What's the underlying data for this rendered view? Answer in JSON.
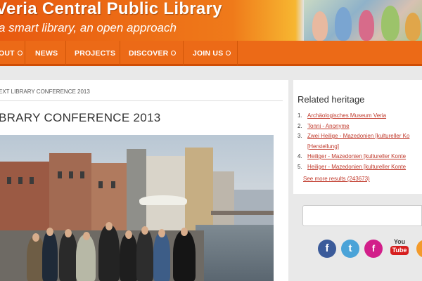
{
  "header": {
    "title": "Veria Central Public Library",
    "tagline": "a smart library, an open approach"
  },
  "nav": {
    "items": [
      {
        "label": "OUT",
        "has_submenu": true
      },
      {
        "label": "NEWS",
        "has_submenu": false
      },
      {
        "label": "PROJECTS",
        "has_submenu": false
      },
      {
        "label": "DISCOVER",
        "has_submenu": true
      },
      {
        "label": "JOIN US",
        "has_submenu": true
      }
    ]
  },
  "main": {
    "breadcrumb": "EXT LIBRARY CONFERENCE 2013",
    "title": "BRARY CONFERENCE 2013"
  },
  "sidebar": {
    "title": "Related heritage",
    "items": [
      {
        "num": "1.",
        "label": "Archäologisches Museum Veria"
      },
      {
        "num": "2.",
        "label": "Tonni - Anonyme"
      },
      {
        "num": "3.",
        "label": "Zwei Heilige - Mazedonien [kultureller Ko"
      },
      {
        "num": "",
        "label": "[Herstellung]"
      },
      {
        "num": "4.",
        "label": "Heiliger - Mazedonien [kultureller Konte"
      },
      {
        "num": "5.",
        "label": "Heiliger - Mazedonien [kultureller Konte"
      }
    ],
    "see_more": "See more results (243673)",
    "social": [
      {
        "icon": "facebook-icon",
        "glyph": "f"
      },
      {
        "icon": "twitter-icon",
        "glyph": "t"
      },
      {
        "icon": "flickr-icon",
        "glyph": "f"
      },
      {
        "icon": "youtube-icon",
        "top": "You",
        "bottom": "Tube"
      },
      {
        "icon": "rss-icon",
        "glyph": "◉"
      }
    ]
  },
  "colors": {
    "header_orange": "#e85a10",
    "nav_orange": "#ec6a17",
    "link_red": "#c0392b"
  }
}
